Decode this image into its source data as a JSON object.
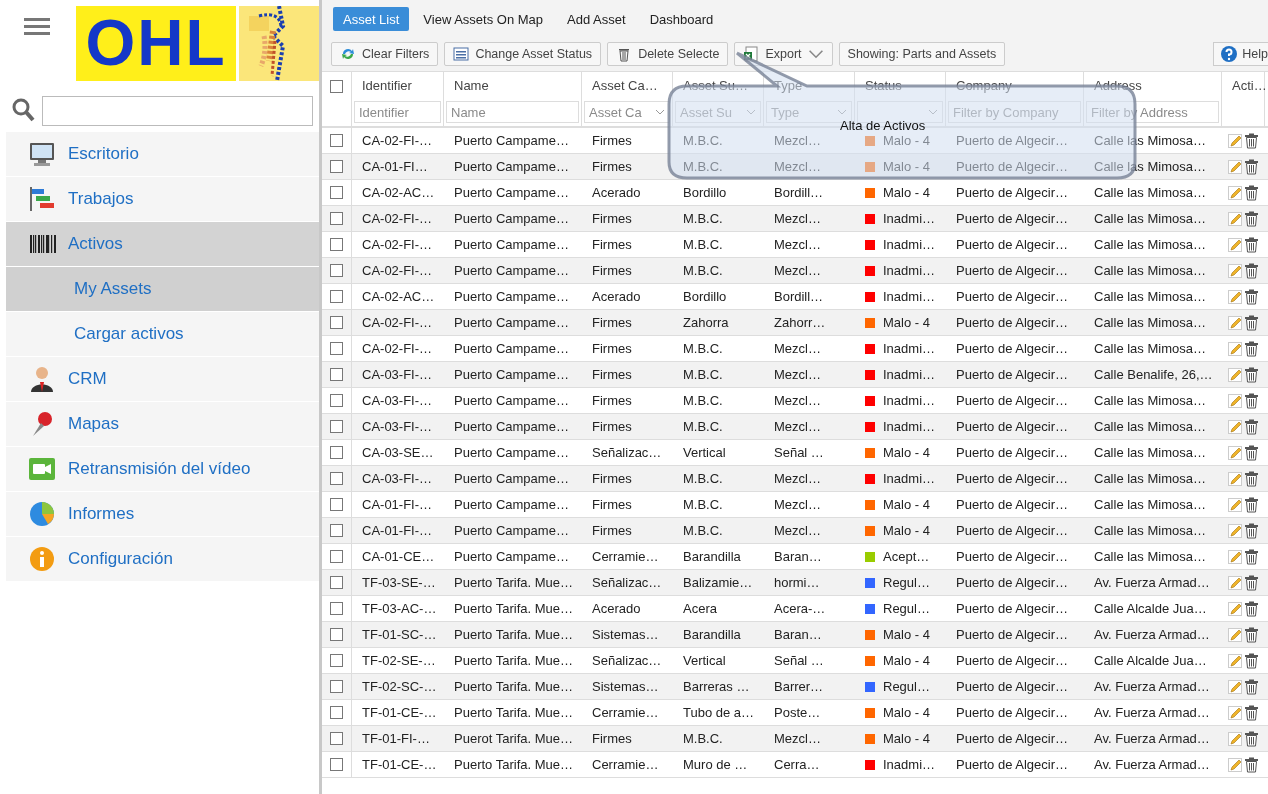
{
  "logo": {
    "text": "OHL",
    "kind": "picture"
  },
  "sidebar": {
    "items": [
      {
        "label": "Escritorio",
        "selected": false
      },
      {
        "label": "Trabajos",
        "selected": false
      },
      {
        "label": "Activos",
        "selected": true,
        "expanded": true,
        "children": [
          {
            "label": "My Assets",
            "selected": true
          },
          {
            "label": "Cargar activos",
            "selected": false
          }
        ]
      },
      {
        "label": "CRM",
        "selected": false
      },
      {
        "label": "Mapas",
        "selected": false
      },
      {
        "label": "Retransmisión del vídeo",
        "selected": false
      },
      {
        "label": "Informes",
        "selected": false
      },
      {
        "label": "Configuración",
        "selected": false
      }
    ]
  },
  "tabs": [
    {
      "label": "Asset List",
      "selected": true
    },
    {
      "label": "View Assets On Map",
      "selected": false
    },
    {
      "label": "Add Asset",
      "selected": false
    },
    {
      "label": "Dashboard",
      "selected": false
    }
  ],
  "toolbar": [
    {
      "label": "Clear Filters",
      "kind": "plain"
    },
    {
      "label": "Change Asset Status",
      "kind": "plain"
    },
    {
      "label": "Delete Selecte",
      "kind": "plain"
    },
    {
      "label": "Export",
      "kind": "split"
    },
    {
      "label": "Showing: Parts and Assets",
      "kind": "plain"
    }
  ],
  "help": {
    "label": "Help"
  },
  "callout": {
    "text": "Alta de Activos"
  },
  "table": {
    "header_checked": false,
    "columns": [
      {
        "label": "Identifier",
        "placeholder": "Identifier",
        "kind": "text"
      },
      {
        "label": "Name",
        "placeholder": "Name",
        "kind": "text"
      },
      {
        "label": "Asset Ca…",
        "placeholder": "Asset Ca",
        "kind": "select"
      },
      {
        "label": "Asset Su…",
        "placeholder": "Asset Su",
        "kind": "select"
      },
      {
        "label": "Type",
        "placeholder": "Type",
        "kind": "select"
      },
      {
        "label": "Status",
        "kind": "select"
      },
      {
        "label": "Company",
        "placeholder": "Filter by Company",
        "kind": "text"
      },
      {
        "label": "Address",
        "placeholder": "Filter by Address",
        "kind": "text"
      },
      {
        "label": "Acti…",
        "kind": "none"
      }
    ],
    "rows": [
      {
        "checked": false,
        "cells": [
          "CA-02-FI-…",
          "Puerto Campame…",
          "Firmes",
          "M.B.C.",
          "Mezcl…",
          "Malo - 4",
          "Puerto de Algecir…",
          "Calle las Mimosa…"
        ],
        "color": "#e6a884"
      },
      {
        "checked": false,
        "cells": [
          "CA-01-FI…",
          "Puerto Campame…",
          "Firmes",
          "M.B.C.",
          "Mezcl…",
          "Malo - 4",
          "Puerto de Algecir…",
          "Calle las Mimosa…"
        ],
        "color": "#e6a884"
      },
      {
        "checked": false,
        "cells": [
          "CA-02-AC…",
          "Puerto Campame…",
          "Acerado",
          "Bordillo",
          "Bordill…",
          "Malo - 4",
          "Puerto de Algecir…",
          "Calle las Mimosa…"
        ],
        "color": "#ff6600"
      },
      {
        "checked": false,
        "cells": [
          "CA-02-FI-…",
          "Puerto Campame…",
          "Firmes",
          "M.B.C.",
          "Mezcl…",
          "Inadmi…",
          "Puerto de Algecir…",
          "Calle las Mimosa…"
        ],
        "color": "#ff0000"
      },
      {
        "checked": false,
        "cells": [
          "CA-02-FI-…",
          "Puerto Campame…",
          "Firmes",
          "M.B.C.",
          "Mezcl…",
          "Inadmi…",
          "Puerto de Algecir…",
          "Calle las Mimosa…"
        ],
        "color": "#ff0000"
      },
      {
        "checked": false,
        "cells": [
          "CA-02-FI-…",
          "Puerto Campame…",
          "Firmes",
          "M.B.C.",
          "Mezcl…",
          "Inadmi…",
          "Puerto de Algecir…",
          "Calle las Mimosa…"
        ],
        "color": "#ff0000"
      },
      {
        "checked": false,
        "cells": [
          "CA-02-AC…",
          "Puerto Campame…",
          "Acerado",
          "Bordillo",
          "Bordill…",
          "Inadmi…",
          "Puerto de Algecir…",
          "Calle las Mimosa…"
        ],
        "color": "#ff0000"
      },
      {
        "checked": false,
        "cells": [
          "CA-02-FI-…",
          "Puerto Campame…",
          "Firmes",
          "Zahorra",
          "Zahorr…",
          "Malo - 4",
          "Puerto de Algecir…",
          "Calle las Mimosa…"
        ],
        "color": "#ff6600"
      },
      {
        "checked": false,
        "cells": [
          "CA-02-FI-…",
          "Puerto Campame…",
          "Firmes",
          "M.B.C.",
          "Mezcl…",
          "Inadmi…",
          "Puerto de Algecir…",
          "Calle las Mimosa…"
        ],
        "color": "#ff0000"
      },
      {
        "checked": false,
        "cells": [
          "CA-03-FI-…",
          "Puerto Campame…",
          "Firmes",
          "M.B.C.",
          "Mezcl…",
          "Inadmi…",
          "Puerto de Algecir…",
          "Calle Benalife, 26,…"
        ],
        "color": "#ff0000"
      },
      {
        "checked": false,
        "cells": [
          "CA-03-FI-…",
          "Puerto Campame…",
          "Firmes",
          "M.B.C.",
          "Mezcl…",
          "Inadmi…",
          "Puerto de Algecir…",
          "Calle las Mimosa…"
        ],
        "color": "#ff0000"
      },
      {
        "checked": false,
        "cells": [
          "CA-03-FI-…",
          "Puerto Campame…",
          "Firmes",
          "M.B.C.",
          "Mezcl…",
          "Inadmi…",
          "Puerto de Algecir…",
          "Calle las Mimosa…"
        ],
        "color": "#ff0000"
      },
      {
        "checked": false,
        "cells": [
          "CA-03-SE…",
          "Puerto Campame…",
          "Señalizac…",
          "Vertical",
          "Señal …",
          "Malo - 4",
          "Puerto de Algecir…",
          "Calle las Mimosa…"
        ],
        "color": "#ff6600"
      },
      {
        "checked": false,
        "cells": [
          "CA-03-FI-…",
          "Puerto Campame…",
          "Firmes",
          "M.B.C.",
          "Mezcl…",
          "Inadmi…",
          "Puerto de Algecir…",
          "Calle las Mimosa…"
        ],
        "color": "#ff0000"
      },
      {
        "checked": false,
        "cells": [
          "CA-01-FI-…",
          "Puerto Campame…",
          "Firmes",
          "M.B.C.",
          "Mezcl…",
          "Malo - 4",
          "Puerto de Algecir…",
          "Calle las Mimosa…"
        ],
        "color": "#ff6600"
      },
      {
        "checked": false,
        "cells": [
          "CA-01-FI-…",
          "Puerto Campame…",
          "Firmes",
          "M.B.C.",
          "Mezcl…",
          "Malo - 4",
          "Puerto de Algecir…",
          "Calle las Mimosa…"
        ],
        "color": "#ff6600"
      },
      {
        "checked": false,
        "cells": [
          "CA-01-CE…",
          "Puerto Campame…",
          "Cerramie…",
          "Barandilla",
          "Baran…",
          "Acept…",
          "Puerto de Algecir…",
          "Calle las Mimosa…"
        ],
        "color": "#99cc00"
      },
      {
        "checked": false,
        "cells": [
          "TF-03-SE-…",
          "Puerto Tarifa. Mue…",
          "Señalizac…",
          "Balizamie…",
          "hormi…",
          "Regul…",
          "Puerto de Algecir…",
          "Av. Fuerza Armad…"
        ],
        "color": "#3366ff"
      },
      {
        "checked": false,
        "cells": [
          "TF-03-AC-…",
          "Puerto Tarifa. Mue…",
          "Acerado",
          "Acera",
          "Acera-…",
          "Regul…",
          "Puerto de Algecir…",
          "Calle Alcalde Jua…"
        ],
        "color": "#3366ff"
      },
      {
        "checked": false,
        "cells": [
          "TF-01-SC-…",
          "Puerto Tarifa. Mue…",
          "Sistemas…",
          "Barandilla",
          "Baran…",
          "Malo - 4",
          "Puerto de Algecir…",
          "Av. Fuerza Armad…"
        ],
        "color": "#ff6600"
      },
      {
        "checked": false,
        "cells": [
          "TF-02-SE-…",
          "Puerto Tarifa. Mue…",
          "Señalizac…",
          "Vertical",
          "Señal …",
          "Malo - 4",
          "Puerto de Algecir…",
          "Calle Alcalde Jua…"
        ],
        "color": "#ff6600"
      },
      {
        "checked": false,
        "cells": [
          "TF-02-SC-…",
          "Puerto Tarifa. Mue…",
          "Sistemas…",
          "Barreras …",
          "Barrer…",
          "Regul…",
          "Puerto de Algecir…",
          "Av. Fuerza Armad…"
        ],
        "color": "#3366ff"
      },
      {
        "checked": false,
        "cells": [
          "TF-01-CE-…",
          "Puerto Tarifa. Mue…",
          "Cerramie…",
          "Tubo de a…",
          "Poste…",
          "Malo - 4",
          "Puerto de Algecir…",
          "Av. Fuerza Armad…"
        ],
        "color": "#ff6600"
      },
      {
        "checked": false,
        "cells": [
          "TF-01-FI-…",
          "Puerot Tarifa. Mue…",
          "Firmes",
          "M.B.C.",
          "Mezcl…",
          "Malo - 4",
          "Puerto de Algecir…",
          "Av. Fuerza Armad…"
        ],
        "color": "#ff6600"
      },
      {
        "checked": false,
        "cells": [
          "TF-01-CE-…",
          "Puerto Tarifa. Mue…",
          "Cerramie…",
          "Muro de …",
          "Cerra…",
          "Inadmi…",
          "Puerto de Algecir…",
          "Av. Fuerza Armad…"
        ],
        "color": "#ff0000"
      }
    ]
  }
}
